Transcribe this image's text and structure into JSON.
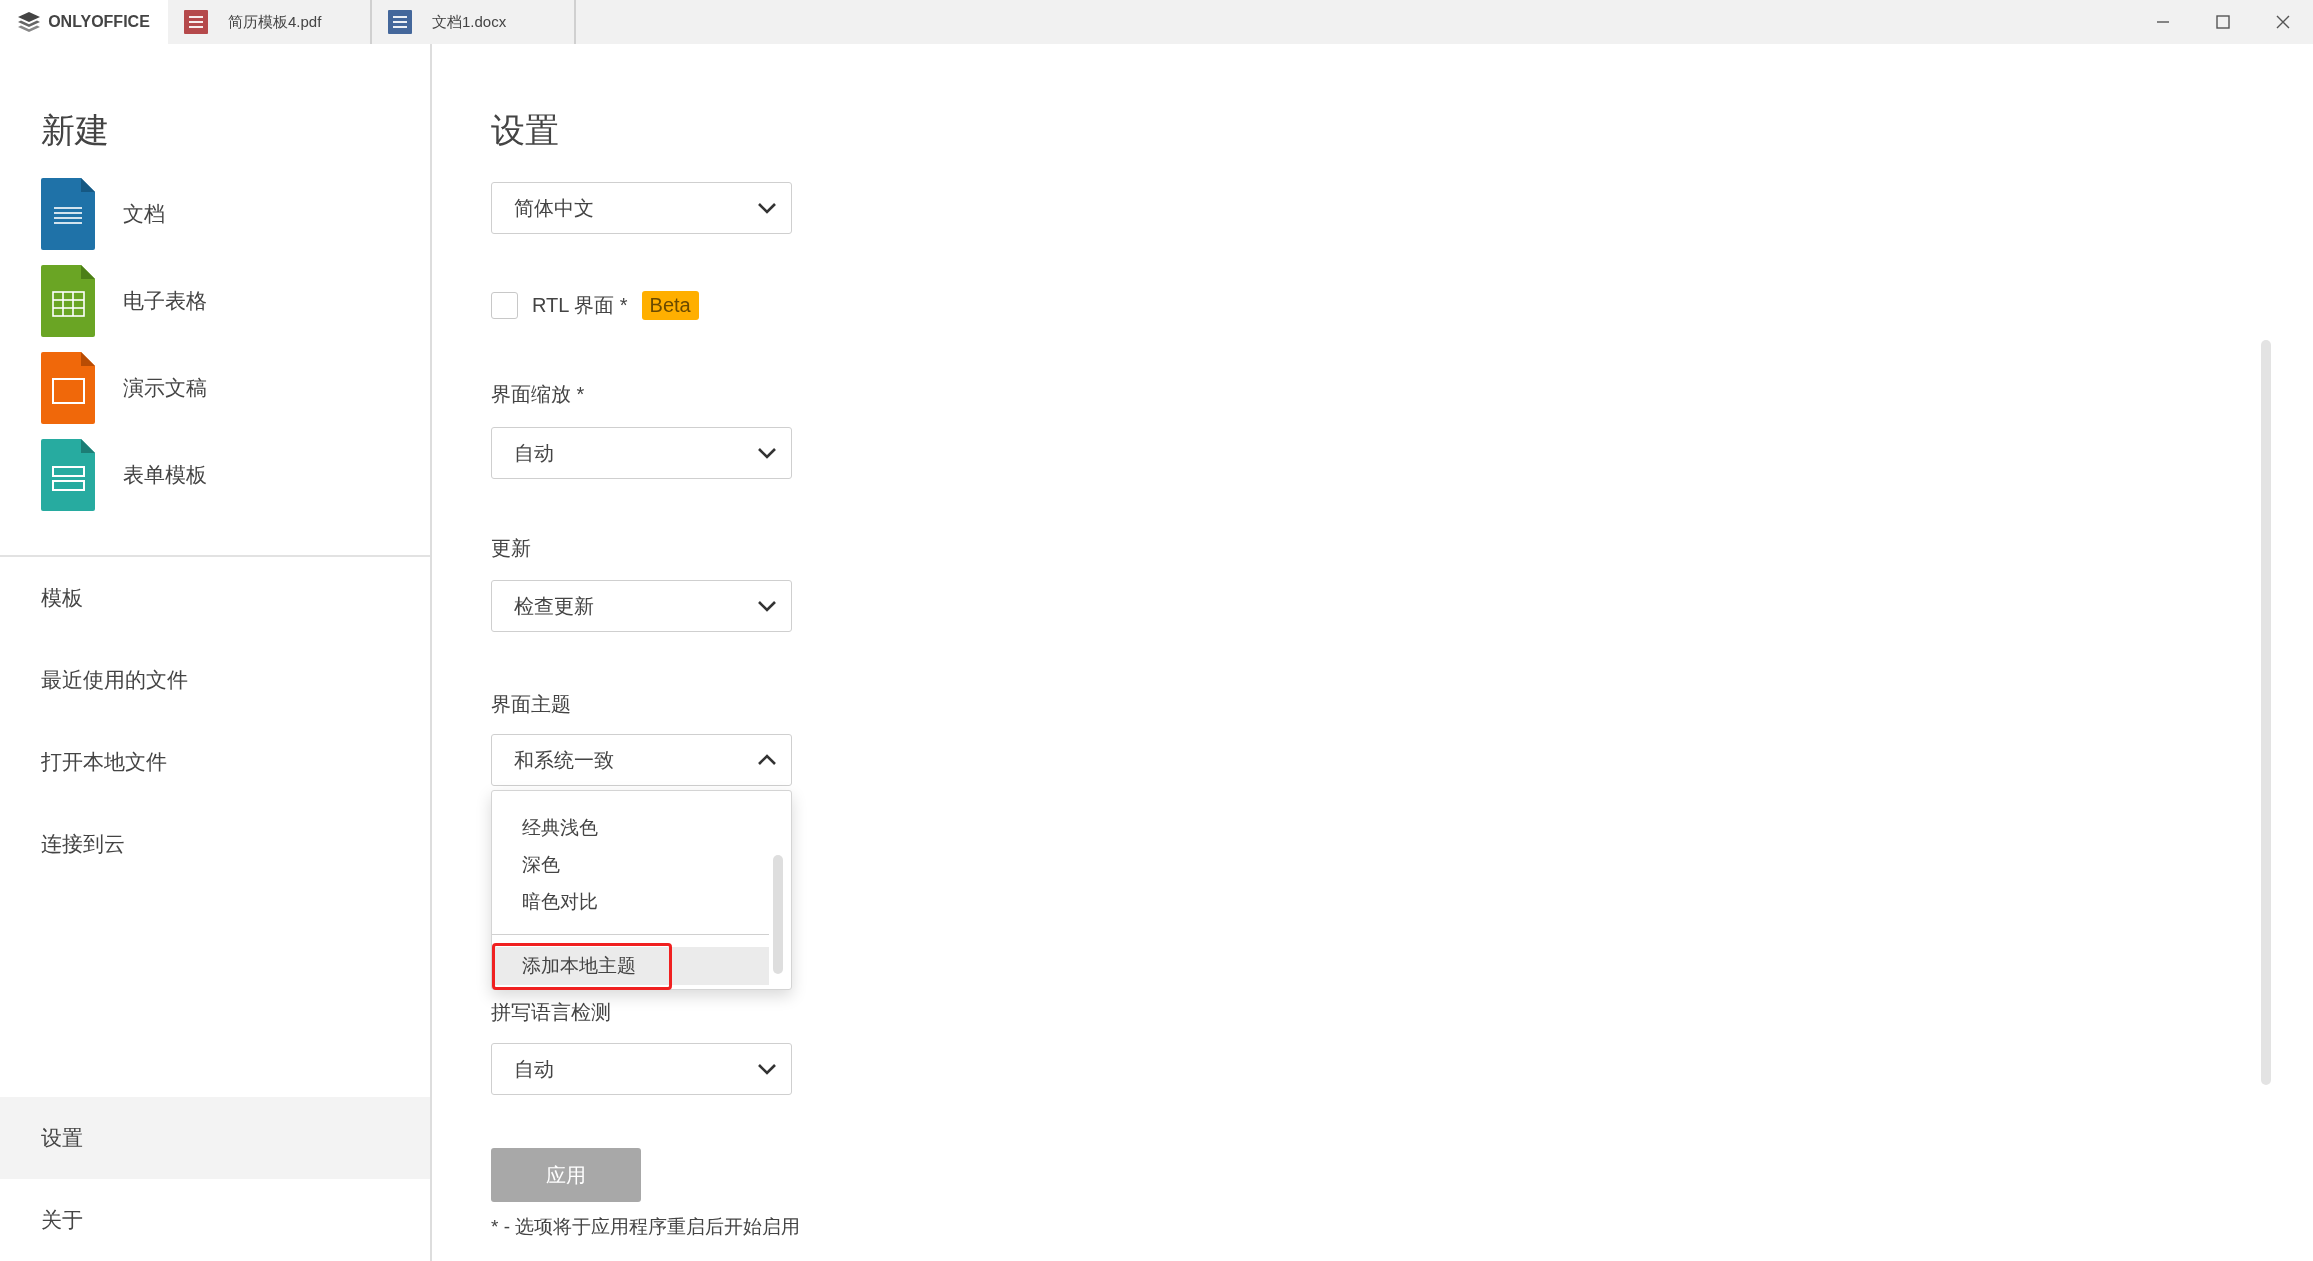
{
  "window": {
    "home_tab": {
      "label": "ONLYOFFICE",
      "selected": true
    },
    "tabs": [
      {
        "label": "简历模板4.pdf",
        "kind": "pdf",
        "selected": false
      },
      {
        "label": "文档1.docx",
        "kind": "docx",
        "selected": false
      }
    ]
  },
  "sidebar": {
    "create_title": "新建",
    "create_items": [
      {
        "label": "文档",
        "kind": "document"
      },
      {
        "label": "电子表格",
        "kind": "spreadsheet"
      },
      {
        "label": "演示文稿",
        "kind": "presentation"
      },
      {
        "label": "表单模板",
        "kind": "form"
      }
    ],
    "nav_items": [
      {
        "label": "模板",
        "selected": false
      },
      {
        "label": "最近使用的文件",
        "selected": false
      },
      {
        "label": "打开本地文件",
        "selected": false
      },
      {
        "label": "连接到云",
        "selected": false
      }
    ],
    "bottom_items": [
      {
        "label": "设置",
        "selected": true
      },
      {
        "label": "关于",
        "selected": false
      }
    ]
  },
  "settings": {
    "title": "设置",
    "language": {
      "value": "简体中文",
      "expanded": false
    },
    "rtl": {
      "label": "RTL 界面 *",
      "checked": false,
      "badge": "Beta"
    },
    "scale": {
      "label": "界面缩放 *",
      "value": "自动",
      "expanded": false
    },
    "updates": {
      "label": "更新",
      "value": "检查更新",
      "expanded": false
    },
    "theme": {
      "label": "界面主题",
      "value": "和系统一致",
      "expanded": true,
      "options": [
        {
          "label": "经典浅色",
          "hovered": false
        },
        {
          "label": "深色",
          "hovered": false
        },
        {
          "label": "暗色对比",
          "hovered": false
        }
      ],
      "action": {
        "label": "添加本地主题",
        "hovered": true,
        "marked": true
      }
    },
    "spellcheck": {
      "label": "拼写语言检测",
      "value": "自动",
      "expanded": false
    },
    "apply_button": {
      "label": "应用",
      "disabled": true
    },
    "footnote": "* - 选项将于应用程序重启后开始启用"
  }
}
